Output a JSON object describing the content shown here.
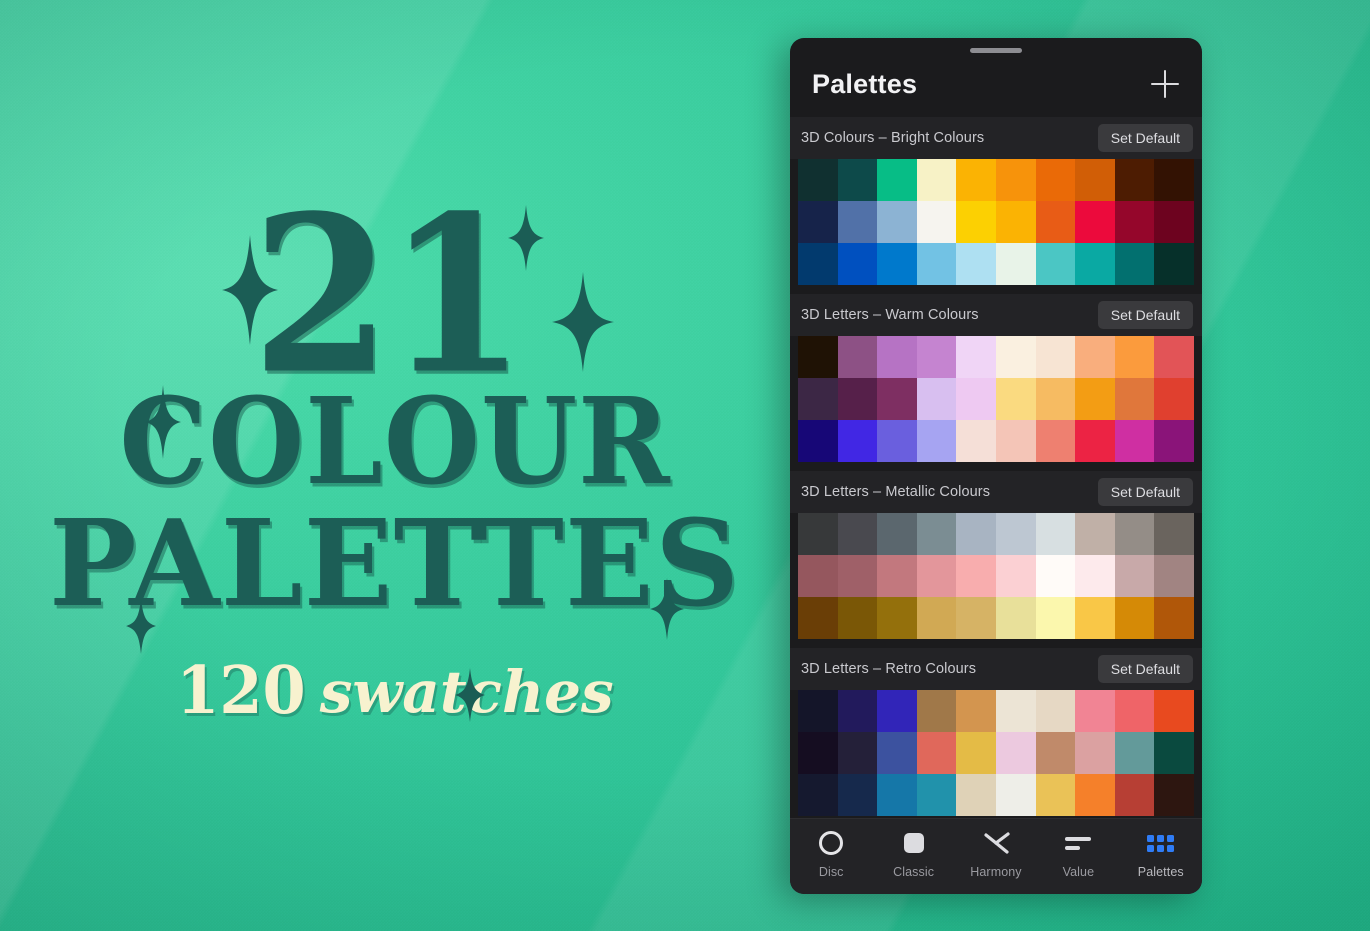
{
  "promo": {
    "number": "21",
    "line1": "COLOUR",
    "line2": "PALETTES",
    "sub_count": "120",
    "sub_word": "swatches",
    "background_color": "#34c99a",
    "ink_color": "#1c5e56",
    "cream_color": "#f7f2cf"
  },
  "phone": {
    "sheet": {
      "title": "Palettes",
      "add_icon": "plus-icon",
      "grabber": "sheet-drag-handle"
    },
    "palettes": [
      {
        "name": "3D Colours – Bright Colours",
        "action_label": "Set Default",
        "swatches": [
          "#103030",
          "#0d4a4a",
          "#07bd86",
          "#f7f2c6",
          "#fbb303",
          "#f7930b",
          "#ea6a07",
          "#d15e06",
          "#4d1c02",
          "#331203",
          "#16234a",
          "#5171a8",
          "#8cb3d3",
          "#f6f4ef",
          "#fcd002",
          "#fbb303",
          "#e85c16",
          "#ec0a3c",
          "#95062b",
          "#6d031f",
          "#023a6e",
          "#0050bf",
          "#0079cc",
          "#72c2e4",
          "#aee0f2",
          "#e8f3e8",
          "#4bc6c4",
          "#0aa9a3",
          "#02706f",
          "#06302a"
        ]
      },
      {
        "name": "3D Letters – Warm Colours",
        "action_label": "Set Default",
        "swatches": [
          "#1f1205",
          "#8d5185",
          "#b673c4",
          "#c584d0",
          "#f0d5f6",
          "#faf0e0",
          "#f7e4d3",
          "#f9ae7d",
          "#fb9b3d",
          "#e25457",
          "#3c2745",
          "#56204a",
          "#7e2f62",
          "#d8bff0",
          "#eec9f2",
          "#fada80",
          "#f6bb62",
          "#f39d14",
          "#e0773b",
          "#e0402f",
          "#170777",
          "#4127e4",
          "#6a5fde",
          "#a6a4f2",
          "#f5dfd7",
          "#f4c5b7",
          "#ee8070",
          "#ec2344",
          "#cf2fa2",
          "#8a1479"
        ]
      },
      {
        "name": "3D Letters – Metallic Colours",
        "action_label": "Set Default",
        "swatches": [
          "#37393a",
          "#49494f",
          "#5b676e",
          "#7b8d93",
          "#a8b4c2",
          "#bdc7d2",
          "#d7dfe1",
          "#c0b0a7",
          "#948d87",
          "#6a645e",
          "#95575e",
          "#9f6068",
          "#c2787e",
          "#e3969b",
          "#f8adae",
          "#fbd0d3",
          "#fffbf8",
          "#fdeaec",
          "#c8a9a9",
          "#a18482",
          "#6a3e06",
          "#7a5706",
          "#94700c",
          "#d1a954",
          "#d6b365",
          "#e8e09a",
          "#fbf7ad",
          "#f9c747",
          "#d58a06",
          "#b05709"
        ]
      },
      {
        "name": "3D Letters – Retro Colours",
        "action_label": "Set Default",
        "swatches": [
          "#141529",
          "#221a5c",
          "#3125b8",
          "#a07849",
          "#d3954f",
          "#ece4d5",
          "#e6d8c4",
          "#f18494",
          "#ef6468",
          "#e84a1f",
          "#150d21",
          "#242039",
          "#3c529f",
          "#e0685b",
          "#e4bb46",
          "#ecc9df",
          "#c08a6a",
          "#dba1a1",
          "#639a9a",
          "#0a4a3f",
          "#15192f",
          "#16294c",
          "#1577a8",
          "#2192ab",
          "#dfd2b7",
          "#eeeee8",
          "#eac257",
          "#f5802a",
          "#b73f34",
          "#2d1610"
        ]
      }
    ],
    "tabs": [
      {
        "label": "Disc",
        "icon": "circle-outline-icon",
        "active": false
      },
      {
        "label": "Classic",
        "icon": "rounded-square-icon",
        "active": false
      },
      {
        "label": "Harmony",
        "icon": "harmony-branch-icon",
        "active": false
      },
      {
        "label": "Value",
        "icon": "value-bars-icon",
        "active": false
      },
      {
        "label": "Palettes",
        "icon": "grid-dots-icon",
        "active": true
      }
    ],
    "accent_color": "#2f7cf6"
  }
}
